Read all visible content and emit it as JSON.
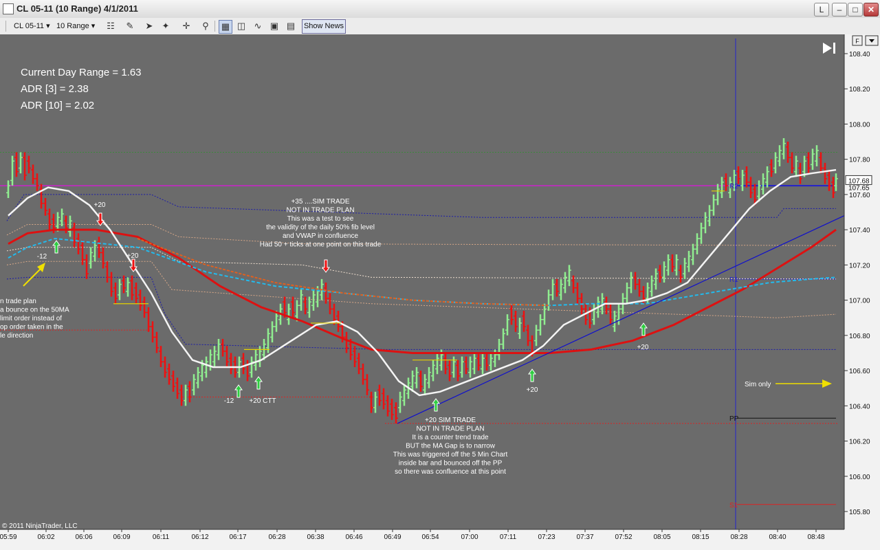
{
  "window": {
    "title": "CL 05-11 (10 Range)  4/1/2011",
    "buttons": [
      "L",
      "–",
      "□",
      "✕"
    ]
  },
  "toolbar": {
    "instrument": "CL 05-11",
    "interval": "10 Range",
    "show_news": "Show News"
  },
  "chart_data": {
    "type": "bar",
    "instrument": "CL 05-11",
    "interval": "10 Range",
    "date": "4/1/2011",
    "y_ticks": [
      "108.40",
      "108.20",
      "108.00",
      "107.80",
      "107.60",
      "107.40",
      "107.20",
      "107.00",
      "106.80",
      "106.60",
      "106.40",
      "106.20",
      "106.00",
      "105.80"
    ],
    "ylim": [
      105.74,
      108.43
    ],
    "last_price": "107.68",
    "last_price_secondary": "107.65",
    "x_ticks": [
      "05:59",
      "06:02",
      "06:06",
      "06:09",
      "06:11",
      "06:12",
      "06:17",
      "06:28",
      "06:38",
      "06:46",
      "06:49",
      "06:54",
      "07:00",
      "07:11",
      "07:23",
      "07:37",
      "07:52",
      "08:05",
      "08:15",
      "08:28",
      "08:40",
      "08:48"
    ],
    "stats": [
      "Current Day Range = 1.63",
      "ADR [3] = 2.38",
      "ADR [10] = 2.02"
    ],
    "copyright": "© 2011 NinjaTrader, LLC",
    "pivots": [
      {
        "label": "R2",
        "value": 107.65
      },
      {
        "label": "R1",
        "value": 107.12
      },
      {
        "label": "PP",
        "value": 106.33
      },
      {
        "label": "S1",
        "value": 105.84
      }
    ],
    "level_prices": {
      "magenta": 107.65,
      "red_low": 106.3,
      "red_mid": 106.83,
      "green_top": 107.84
    },
    "annotations": [
      {
        "text": "+20",
        "lines": [
          "+20"
        ]
      },
      {
        "text": "-12",
        "lines": [
          "-12"
        ]
      },
      {
        "text": "+20",
        "lines": [
          "+20"
        ]
      },
      {
        "text": "trade plan note",
        "lines": [
          "n trade plan",
          "a bounce on the 50MA",
          "limit order instead of",
          "op order taken in the",
          "le direction"
        ]
      },
      {
        "text": "sim trade 1",
        "lines": [
          "+35 ....SIM TRADE",
          "NOT IN TRADE PLAN",
          "This was a test to see",
          "the validity of the daily 50% fib level",
          "and VWAP in confluence",
          "Had 50 + ticks at one point on this trade"
        ]
      },
      {
        "text": "-12b",
        "lines": [
          "-12"
        ]
      },
      {
        "text": "ctt",
        "lines": [
          "+20 CTT"
        ]
      },
      {
        "text": "sim trade 2",
        "lines": [
          "+20 SIM TRADE",
          "NOT IN TRADE PLAN",
          "It is a counter trend trade",
          "BUT the MA Gap is to narrow",
          "This was triggered off the 5 Min Chart",
          "inside bar and bounced off the PP",
          "so there was confluence at this point"
        ]
      },
      {
        "text": "+20c",
        "lines": [
          "+20"
        ]
      },
      {
        "text": "+20d",
        "lines": [
          "+20"
        ]
      },
      {
        "text": "sim only",
        "lines": [
          "Sim only"
        ]
      }
    ],
    "series_colors": {
      "up": "#90ee90",
      "down": "#ee1111",
      "ma_white": "#f4f4f4",
      "ma_red": "#dd1111",
      "vwap": "#22bbee",
      "ema_orange": "#e06020",
      "trend_line": "#1010cc",
      "channel_blue": "#1010aa"
    }
  }
}
